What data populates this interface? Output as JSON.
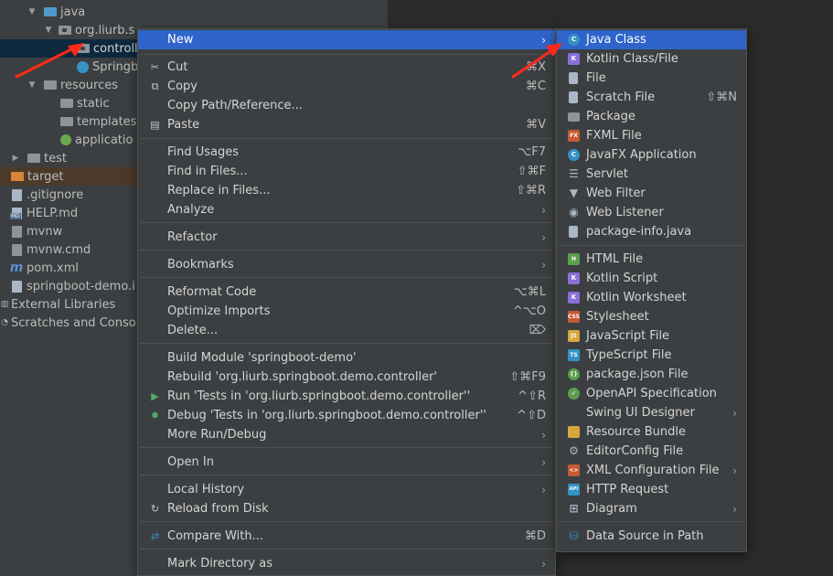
{
  "tree": {
    "rows": [
      {
        "label": "java"
      },
      {
        "label": "org.liurb.s"
      },
      {
        "label": "controll"
      },
      {
        "label": "Springb"
      },
      {
        "label": "resources"
      },
      {
        "label": "static"
      },
      {
        "label": "templates"
      },
      {
        "label": "applicatio"
      },
      {
        "label": "test"
      },
      {
        "label": "target"
      },
      {
        "label": ".gitignore"
      },
      {
        "label": "HELP.md"
      },
      {
        "label": "mvnw"
      },
      {
        "label": "mvnw.cmd"
      },
      {
        "label": "pom.xml"
      },
      {
        "label": "springboot-demo.i"
      },
      {
        "label": "External Libraries"
      },
      {
        "label": "Scratches and Conso"
      }
    ]
  },
  "main_menu": {
    "items": [
      {
        "label": "New",
        "shortcut": "",
        "submenu": true,
        "icon": ""
      },
      {
        "label": "Cut",
        "shortcut": "⌘X",
        "icon": "scissors-icon"
      },
      {
        "label": "Copy",
        "shortcut": "⌘C",
        "icon": "copy-icon"
      },
      {
        "label": "Copy Path/Reference...",
        "shortcut": ""
      },
      {
        "label": "Paste",
        "shortcut": "⌘V",
        "icon": "paste-icon"
      },
      {
        "label": "Find Usages",
        "shortcut": "⌥F7"
      },
      {
        "label": "Find in Files...",
        "shortcut": "⇧⌘F"
      },
      {
        "label": "Replace in Files...",
        "shortcut": "⇧⌘R"
      },
      {
        "label": "Analyze",
        "submenu": true
      },
      {
        "label": "Refactor",
        "submenu": true
      },
      {
        "label": "Bookmarks",
        "submenu": true
      },
      {
        "label": "Reformat Code",
        "shortcut": "⌥⌘L"
      },
      {
        "label": "Optimize Imports",
        "shortcut": "^⌥O"
      },
      {
        "label": "Delete...",
        "shortcut": "⌦"
      },
      {
        "label": "Build Module 'springboot-demo'",
        "shortcut": ""
      },
      {
        "label": "Rebuild 'org.liurb.springboot.demo.controller'",
        "shortcut": "⇧⌘F9"
      },
      {
        "label": "Run 'Tests in 'org.liurb.springboot.demo.controller''",
        "shortcut": "^⇧R",
        "icon": "run-icon"
      },
      {
        "label": "Debug 'Tests in 'org.liurb.springboot.demo.controller''",
        "shortcut": "^⇧D",
        "icon": "debug-icon"
      },
      {
        "label": "More Run/Debug",
        "submenu": true
      },
      {
        "label": "Open In",
        "submenu": true
      },
      {
        "label": "Local History",
        "submenu": true
      },
      {
        "label": "Reload from Disk",
        "shortcut": "",
        "icon": "reload-icon"
      },
      {
        "label": "Compare With...",
        "shortcut": "⌘D",
        "icon": "compare-icon"
      },
      {
        "label": "Mark Directory as",
        "submenu": true
      }
    ]
  },
  "sub_menu": {
    "items": [
      {
        "label": "Java Class",
        "icon": "java-class-icon",
        "color": "#3592c4"
      },
      {
        "label": "Kotlin Class/File",
        "icon": "kotlin-icon",
        "color": "#8a6fd6"
      },
      {
        "label": "File",
        "icon": "file-icon",
        "color": "#a9b7c6"
      },
      {
        "label": "Scratch File",
        "shortcut": "⇧⌘N",
        "icon": "scratch-file-icon",
        "color": "#a9b7c6"
      },
      {
        "label": "Package",
        "icon": "package-icon",
        "color": "#8f9498"
      },
      {
        "label": "FXML File",
        "icon": "fxml-icon",
        "color": "#c75a33"
      },
      {
        "label": "JavaFX Application",
        "icon": "javafx-icon",
        "color": "#3592c4"
      },
      {
        "label": "Servlet",
        "icon": "servlet-icon",
        "color": "#a9b7c6"
      },
      {
        "label": "Web Filter",
        "icon": "filter-icon",
        "color": "#a9b7c6"
      },
      {
        "label": "Web Listener",
        "icon": "listener-icon",
        "color": "#a9b7c6"
      },
      {
        "label": "package-info.java",
        "icon": "package-info-icon",
        "color": "#a9b7c6"
      },
      {
        "label": "HTML File",
        "icon": "html-icon",
        "color": "#5c9e4c"
      },
      {
        "label": "Kotlin Script",
        "icon": "kotlin-script-icon",
        "color": "#8a6fd6"
      },
      {
        "label": "Kotlin Worksheet",
        "icon": "kotlin-worksheet-icon",
        "color": "#8a6fd6"
      },
      {
        "label": "Stylesheet",
        "icon": "css-icon",
        "color": "#c75a33"
      },
      {
        "label": "JavaScript File",
        "icon": "js-icon",
        "color": "#d6a73c"
      },
      {
        "label": "TypeScript File",
        "icon": "ts-icon",
        "color": "#3592c4"
      },
      {
        "label": "package.json File",
        "icon": "npm-icon",
        "color": "#5c9e4c"
      },
      {
        "label": "OpenAPI Specification",
        "icon": "openapi-icon",
        "color": "#5c9e4c"
      },
      {
        "label": "Swing UI Designer",
        "submenu": true
      },
      {
        "label": "Resource Bundle",
        "icon": "resource-bundle-icon",
        "color": "#d6a73c"
      },
      {
        "label": "EditorConfig File",
        "icon": "gear-icon",
        "color": "#a9b7c6"
      },
      {
        "label": "XML Configuration File",
        "submenu": true,
        "icon": "xml-icon",
        "color": "#c75a33"
      },
      {
        "label": "HTTP Request",
        "icon": "api-icon",
        "color": "#3592c4"
      },
      {
        "label": "Diagram",
        "submenu": true,
        "icon": "diagram-icon",
        "color": "#a9b7c6"
      },
      {
        "label": "Data Source in Path",
        "icon": "database-icon",
        "color": "#3592c4"
      }
    ]
  },
  "colors": {
    "highlight": "#2f65ca",
    "annotation_arrow": "#ff2a1a",
    "menu_bg": "#3c3f41",
    "tree_bg": "#3c3f41"
  }
}
